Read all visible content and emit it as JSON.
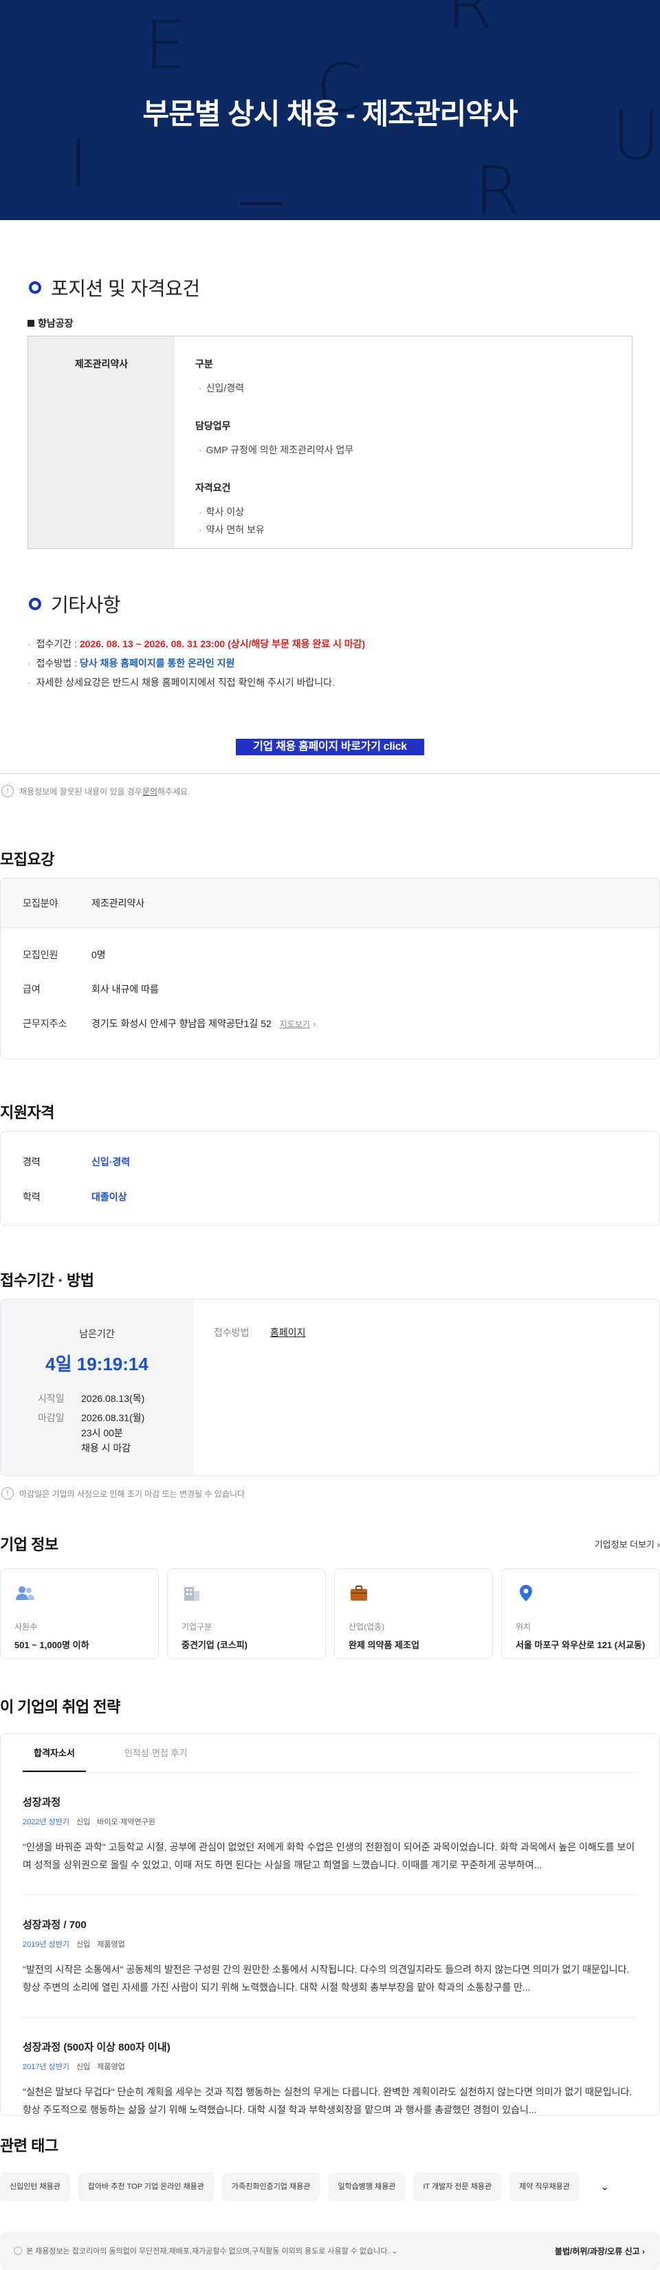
{
  "hero": {
    "title": "부문별 상시 채용 - 제조관리약사",
    "ghost_letters": [
      "E",
      "R",
      "C",
      "I",
      "U",
      "R"
    ]
  },
  "position": {
    "section_title": "포지션 및 자격요건",
    "plant": "향남공장",
    "job": "제조관리약사",
    "groups": [
      {
        "heading": "구분",
        "items": [
          "신입/경력"
        ]
      },
      {
        "heading": "담당업무",
        "items": [
          "GMP 규정에 의한 제조관리약사 업무"
        ]
      },
      {
        "heading": "자격요건",
        "items": [
          "학사 이상",
          "약사 면허 보유"
        ]
      }
    ]
  },
  "etc": {
    "section_title": "기타사항",
    "period_label": "접수기간 : ",
    "period_value": "2026. 08. 13 ~ 2026. 08. 31 23:00 (상시/해당 부문 채용 완료 시 마감)",
    "method_label": "접수방법 : ",
    "method_value": "당사 채용 홈페이지를 통한 온라인 지원",
    "detail": "자세한 상세요강은 반드시 채용 홈페이지에서 직접 확인해 주시기 바랍니다.",
    "cta": "기업 채용 홈페이지 바로가기 click"
  },
  "report_notice": {
    "prefix": "채용정보에 잘못된 내용이 있을 경우 ",
    "link": "문의",
    "suffix": "해주세요."
  },
  "recruit": {
    "title": "모집요강",
    "field_label": "모집분야",
    "field_value": "제조관리약사",
    "rows": [
      {
        "label": "모집인원",
        "value": "0명"
      },
      {
        "label": "급여",
        "value": "회사 내규에 따름"
      },
      {
        "label": "근무지주소",
        "value": "경기도 화성시 안세구 향남읍 제약공단1길 52"
      }
    ],
    "map_link": "지도보기"
  },
  "qual": {
    "title": "지원자격",
    "rows": [
      {
        "label": "경력",
        "value": "신입·경력"
      },
      {
        "label": "학력",
        "value": "대졸이상"
      }
    ]
  },
  "period": {
    "title": "접수기간 · 방법",
    "remaining_label": "남은기간",
    "countdown": "4일 19:19:14",
    "start_label": "시작일",
    "start_value": "2026.08.13(목)",
    "end_label": "마감일",
    "end_value": "2026.08.31(월)",
    "end_time": "23시 00분",
    "end_note": "채용 시 마감",
    "method_label": "접수방법",
    "method_value": "홈페이지",
    "notice": "마감일은 기업의 사정으로 인해 조기 마감 또는 변경될 수 있습니다"
  },
  "company": {
    "title": "기업 정보",
    "more": "기업정보 더보기",
    "cards": [
      {
        "icon": "people-icon",
        "label": "사원수",
        "value": "501 ~ 1,000명 이하"
      },
      {
        "icon": "building-icon",
        "label": "기업구분",
        "value": "중견기업 (코스피)"
      },
      {
        "icon": "briefcase-icon",
        "label": "산업(업종)",
        "value": "완제 의약품 제조업"
      },
      {
        "icon": "location-pin-icon",
        "label": "위치",
        "value": "서울 마포구 와우산로 121 (서교동)"
      }
    ]
  },
  "strategy": {
    "title": "이 기업의 취업 전략",
    "tabs": [
      "합격자소서",
      "인적성·면접 후기"
    ],
    "essays": [
      {
        "title": "성장과정",
        "year": "2022년 상반기",
        "type": "신입",
        "dept": "바이오·제약연구원",
        "body": "\"인생을 바꿔준 과학\" 고등학교 시절, 공부에 관심이 없었던 저에게 화학 수업은 인생의 전환점이 되어준 과목이었습니다. 화학 과목에서 높은 이해도를 보이며 성적을 상위권으로 올릴 수 있었고, 이때 저도 하면 된다는 사실을 깨닫고 희열을 느꼈습니다. 이때를 계기로 꾸준하게 공부하여..."
      },
      {
        "title": "성장과정 / 700",
        "year": "2019년 상반기",
        "type": "신입",
        "dept": "제품영업",
        "body": "\"발전의 시작은 소통에서\" 공동체의 발전은 구성원 간의 원만한 소통에서 시작됩니다. 다수의 의견일지라도 들으려 하지 않는다면 의미가 없기 때문입니다. 항상 주변의 소리에 열린 자세를 가진 사람이 되기 위해 노력했습니다. 대학 시절 학생회 총부부장을 맡아 학과의 소통창구를 만..."
      },
      {
        "title": "성장과정 (500자 이상 800자 이내)",
        "year": "2017년 상반기",
        "type": "신입",
        "dept": "제품영업",
        "body": "\"실천은 말보다 무겁다\" 단순히 계획을 세우는 것과 직접 행동하는 실천의 무게는 다릅니다. 완벽한 계획이라도 실천하지 않는다면 의미가 없기 때문입니다. 항상 주도적으로 행동하는 삶을 살기 위해 노력했습니다. 대학 시절 학과 부학생회장을 맡으며 과 행사를 총괄했던 경험이 있습니..."
      }
    ]
  },
  "tags": {
    "title": "관련 태그",
    "items": [
      "신입인턴 채용관",
      "잡아바 추천 TOP 기업 온라인 채용관",
      "가족친화인증기업 채용관",
      "일학습병행 채용관",
      "IT 개발자 전문 채용관",
      "제약 직무채용관"
    ]
  },
  "footer": {
    "copyright": "본 채용정보는 잡코리아의 동의없이 무단전재,재배포,재가공할수 없으며,구직활동 이외의 용도로 사용할 수 없습니다.",
    "report": "불법/허위/과장/오류 신고"
  }
}
